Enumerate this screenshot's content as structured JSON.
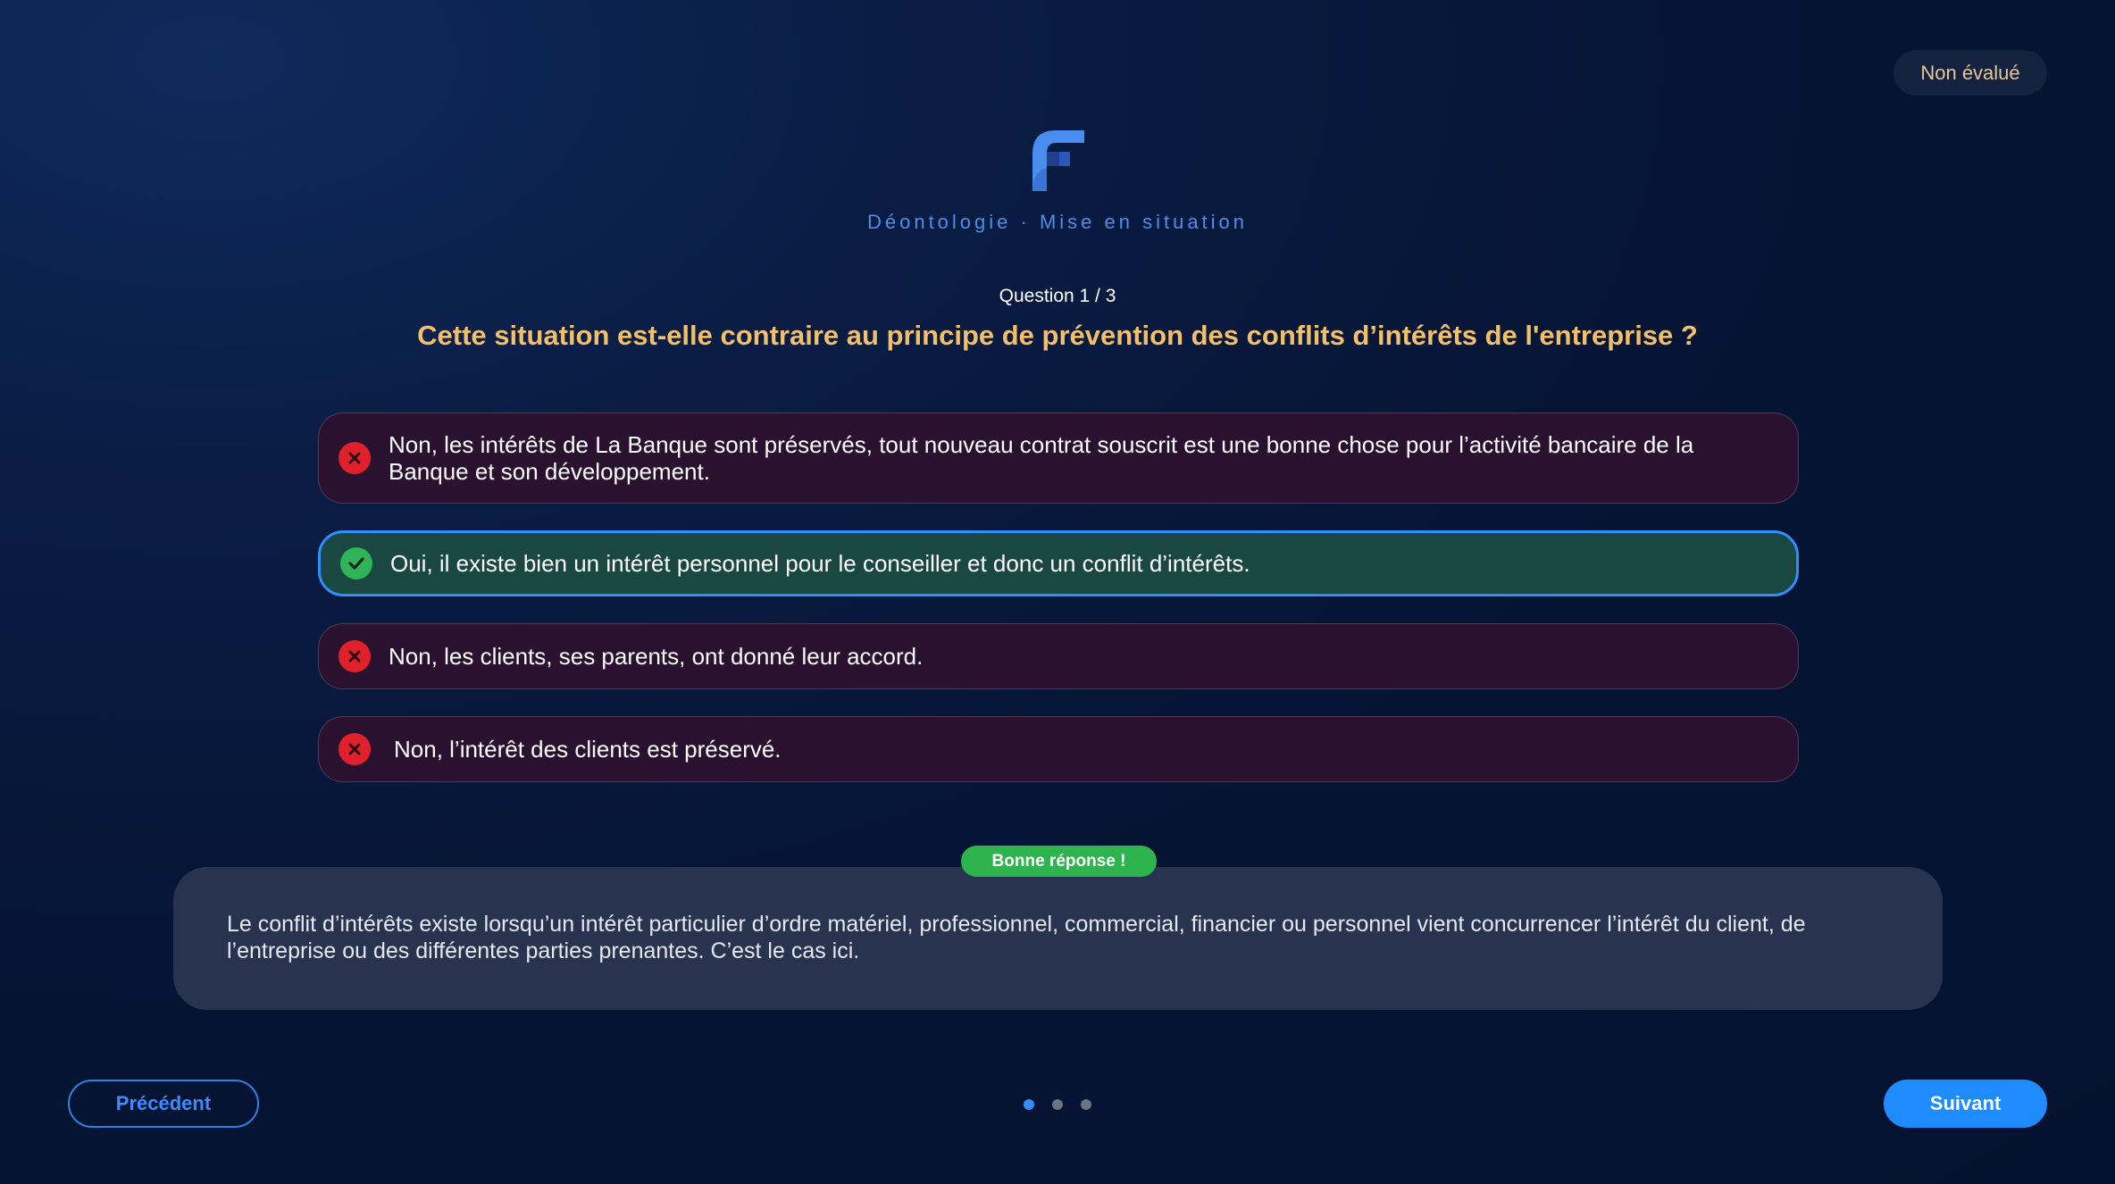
{
  "status": {
    "label": "Non évalué"
  },
  "header": {
    "subtitle": "Déontologie · Mise en situation"
  },
  "question": {
    "counter": "Question 1 / 3",
    "text": "Cette situation est-elle contraire au principe de prévention des conflits d’intérêts de l'entreprise ?"
  },
  "answers": [
    {
      "text": "Non, les intérêts de La Banque sont préservés, tout nouveau contrat souscrit est une bonne chose pour l’activité bancaire de la Banque et son développement.",
      "status": "wrong",
      "icon": "cross-icon"
    },
    {
      "text": "Oui, il existe bien un intérêt personnel pour le conseiller et donc un conflit d’intérêts.",
      "status": "correct",
      "icon": "check-icon"
    },
    {
      "text": "Non, les clients, ses parents, ont donné leur accord.",
      "status": "wrong",
      "icon": "cross-icon"
    },
    {
      "text": "Non, l’intérêt des clients est préservé.",
      "status": "wrong",
      "icon": "cross-icon"
    }
  ],
  "feedback": {
    "badge": "Bonne réponse !",
    "text": "Le conflit d’intérêts existe lorsqu’un intérêt particulier d’ordre matériel, professionnel, commercial, financier ou personnel vient concurrencer l’intérêt du client, de l’entreprise ou des différentes parties prenantes. C’est le cas ici."
  },
  "navigation": {
    "prev_label": "Précédent",
    "next_label": "Suivant",
    "pagination": {
      "current": 1,
      "total": 3
    }
  },
  "colors": {
    "accent": "#1e8cff",
    "question": "#f2bf6b",
    "correct": "#2eb44f",
    "wrong": "#e0202a"
  }
}
